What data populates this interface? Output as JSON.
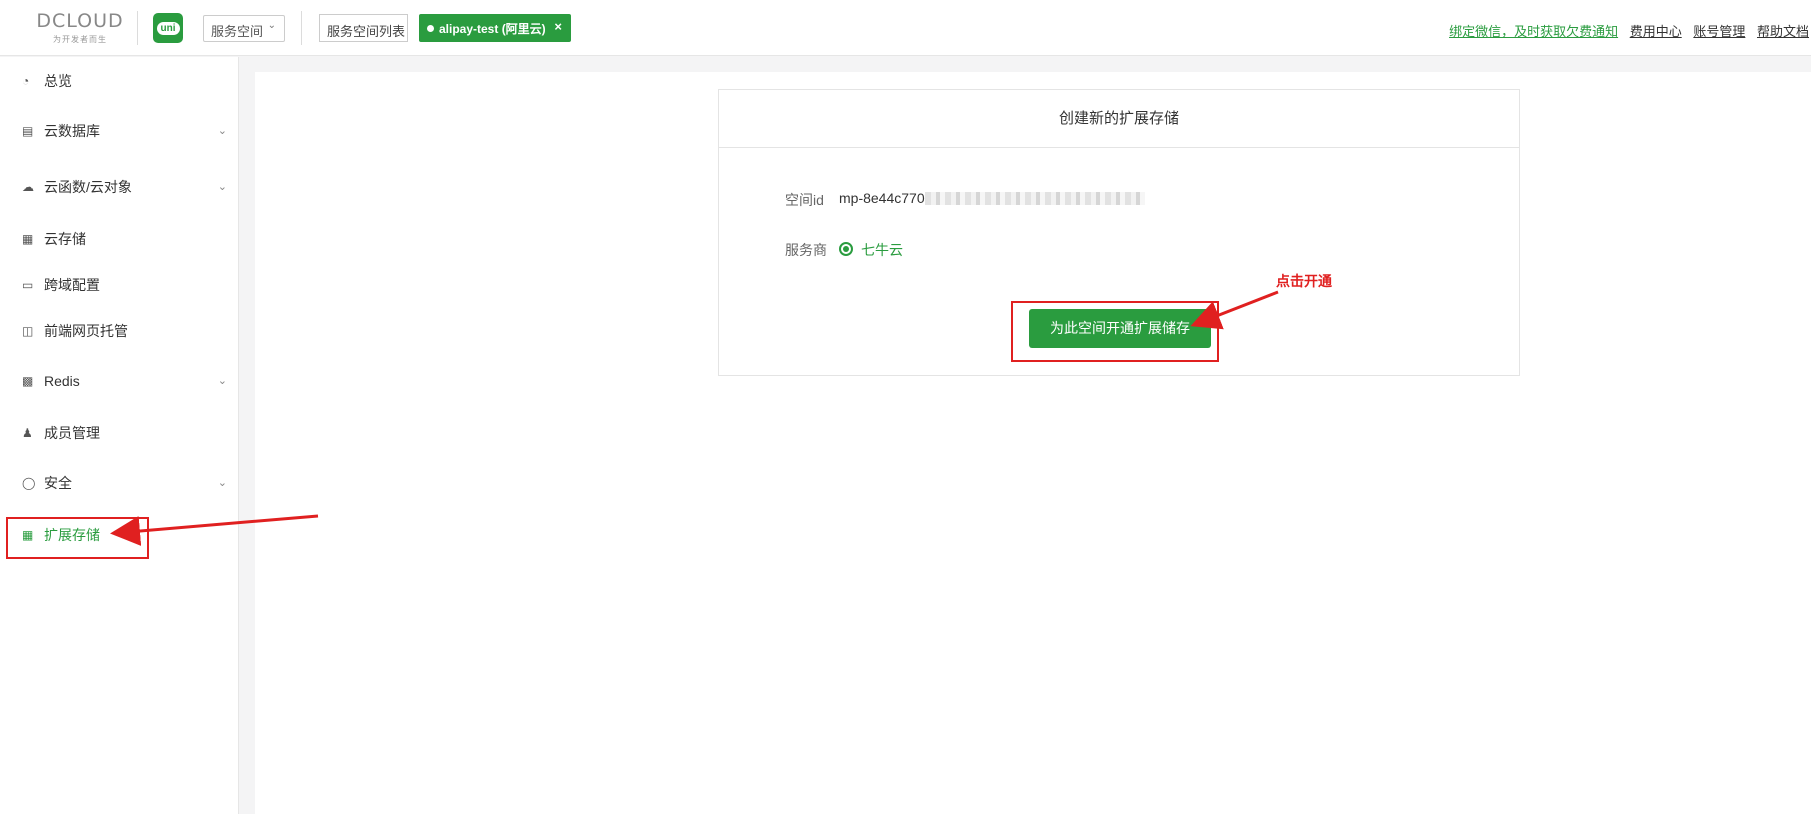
{
  "header": {
    "logo_text": "DCLOUD",
    "logo_tagline": "为开发者而生",
    "uni_badge": "uni",
    "space_select": "服务空间",
    "space_list_button": "服务空间列表",
    "active_space_tag": "alipay-test (阿里云)",
    "close_symbol": "×",
    "links": {
      "bind_wechat": "绑定微信，及时获取欠费通知",
      "billing": "费用中心",
      "account": "账号管理",
      "help": "帮助文档"
    }
  },
  "sidebar": {
    "items": [
      {
        "label": "总览",
        "icon": "pie-chart-icon",
        "has_children": false
      },
      {
        "label": "云数据库",
        "icon": "database-icon",
        "has_children": true
      },
      {
        "label": "云函数/云对象",
        "icon": "cloud-icon",
        "has_children": true
      },
      {
        "label": "云存储",
        "icon": "storage-icon",
        "has_children": false
      },
      {
        "label": "跨域配置",
        "icon": "cross-domain-icon",
        "has_children": false
      },
      {
        "label": "前端网页托管",
        "icon": "web-hosting-icon",
        "has_children": false
      },
      {
        "label": "Redis",
        "icon": "redis-icon",
        "has_children": true
      },
      {
        "label": "成员管理",
        "icon": "user-icon",
        "has_children": false
      },
      {
        "label": "安全",
        "icon": "shield-icon",
        "has_children": true
      },
      {
        "label": "扩展存储",
        "icon": "extended-storage-icon",
        "has_children": false,
        "active": true
      }
    ]
  },
  "card": {
    "title": "创建新的扩展存储",
    "space_id_label": "空间id",
    "space_id_value": "mp-8e44c770",
    "provider_label": "服务商",
    "provider_value": "七牛云",
    "open_button": "为此空间开通扩展储存"
  },
  "annotation": {
    "text": "点击开通"
  },
  "colors": {
    "brand_green": "#2a9c3f",
    "annotation_red": "#e02020"
  }
}
